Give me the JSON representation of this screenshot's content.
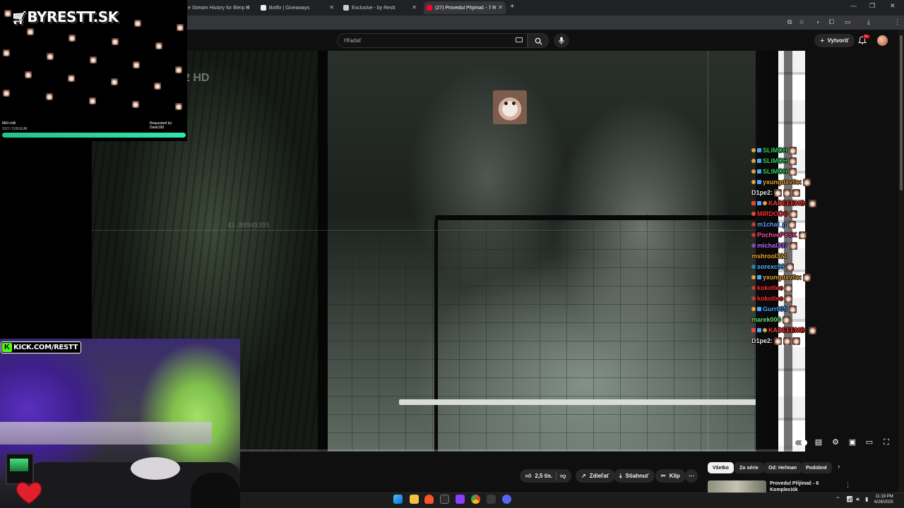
{
  "browser": {
    "tabs": [
      {
        "label": "e Stream History for Blerp U",
        "active": false
      },
      {
        "label": "Botfix | Giveaways",
        "active": false
      },
      {
        "label": "Exclusive - by Restt",
        "active": false
      },
      {
        "label": "(27) Provedul Přijímač - 7 Rozh",
        "active": true
      }
    ],
    "new_tab": "+",
    "profile_initial": "M"
  },
  "youtube": {
    "search_placeholder": "Hľadať",
    "create_label": "Vytvoriť",
    "notif_badge": "9+",
    "video_watermark": "2 HD",
    "video_coord": "41.88945395",
    "actions": {
      "likes": "2,5 tis.",
      "share": "Zdieľať",
      "download": "Stiahnuť",
      "clip": "Klip",
      "more": "⋯"
    },
    "chips": [
      {
        "label": "Všetko",
        "active": true
      },
      {
        "label": "Zo série",
        "active": false
      },
      {
        "label": "Od: Heřman",
        "active": false
      },
      {
        "label": "Podobné",
        "active": false
      }
    ],
    "recommended": {
      "title": "Provedul Přijímač - 6 Kompleciók"
    }
  },
  "overlay": {
    "logo": "BYRESTT.SK",
    "song_title": "Mišl mšli",
    "song_time": "3:57 / 2:00 EUR",
    "requested_by": "Requested by: Dank168",
    "kick_label": "KICK.COM/RESTT"
  },
  "chat": [
    {
      "user": "SLIMOH",
      "color": "#2dd05a"
    },
    {
      "user": "SLIMOH",
      "color": "#2dd05a"
    },
    {
      "user": "SLIMOH",
      "color": "#2dd05a"
    },
    {
      "user": "yxungdxvile:",
      "color": "#e8a33c"
    },
    {
      "user": "D1pe2:",
      "color": "#e9e9e9"
    },
    {
      "user": "KADEEEMB:",
      "color": "#ff3b3b"
    },
    {
      "user": "MIRDOOO",
      "color": "#ff2e2e"
    },
    {
      "user": "m1chal_p",
      "color": "#5aa0ff"
    },
    {
      "user": "PochvePYSK",
      "color": "#ff4fa3"
    },
    {
      "user": "michal337",
      "color": "#b66bff"
    },
    {
      "user": "mshrool321",
      "color": "#f0a330"
    },
    {
      "user": "sorexc99",
      "color": "#5fb0ff"
    },
    {
      "user": "yxungdxvile:",
      "color": "#e8a33c"
    },
    {
      "user": "kokotleo",
      "color": "#ff2e2e"
    },
    {
      "user": "kokotleo",
      "color": "#ff2e2e"
    },
    {
      "user": "Gurr005",
      "color": "#4da6ff"
    },
    {
      "user": "marek000",
      "color": "#6ee06e"
    },
    {
      "user": "KADEEEMB:",
      "color": "#ff3b3b"
    },
    {
      "user": "D1pe2:",
      "color": "#e9e9e9"
    }
  ],
  "taskbar": {
    "time": "11:19 PM",
    "date": "6/26/2025"
  }
}
